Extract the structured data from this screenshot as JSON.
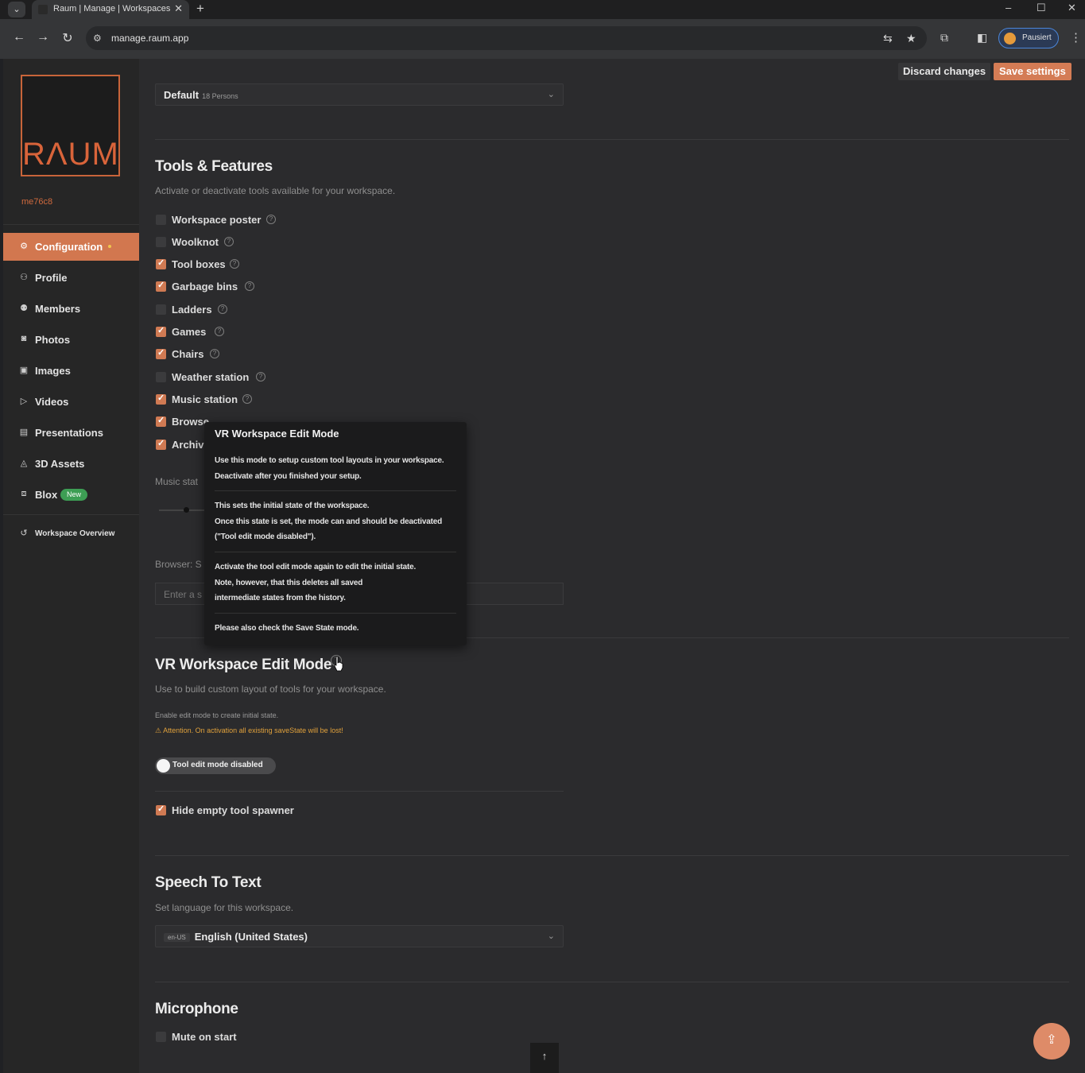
{
  "browser": {
    "tab_title": "Raum | Manage | Workspaces",
    "tab_close": "✕",
    "new_tab": "+",
    "url": "manage.raum.app",
    "profile_label": "Pausiert",
    "window_controls": [
      "–",
      "☐",
      "✕"
    ]
  },
  "sidebar": {
    "logo_text": "RΛUM",
    "user_tag": "me76c8",
    "items": [
      {
        "label": "Configuration",
        "icon": "gear-icon",
        "active": true
      },
      {
        "label": "Profile",
        "icon": "person-icon"
      },
      {
        "label": "Members",
        "icon": "members-icon"
      },
      {
        "label": "Photos",
        "icon": "camera-icon"
      },
      {
        "label": "Images",
        "icon": "image-icon"
      },
      {
        "label": "Videos",
        "icon": "video-icon"
      },
      {
        "label": "Presentations",
        "icon": "presentation-icon"
      },
      {
        "label": "3D Assets",
        "icon": "3d-icon"
      },
      {
        "label": "Blox",
        "icon": "blox-icon",
        "badge": "New"
      },
      {
        "label": "Workspace Overview",
        "icon": "back-icon"
      }
    ]
  },
  "header": {
    "discard_label": "Discard changes",
    "save_label": "Save settings"
  },
  "default_select": {
    "value": "Default",
    "sub": "18 Persons"
  },
  "tools": {
    "title": "Tools & Features",
    "description": "Activate or deactivate tools available for your workspace.",
    "items": [
      {
        "label": "Workspace poster",
        "checked": false
      },
      {
        "label": "Woolknot",
        "checked": false
      },
      {
        "label": "Tool boxes",
        "checked": true
      },
      {
        "label": "Garbage bins",
        "checked": true
      },
      {
        "label": "Ladders",
        "checked": false
      },
      {
        "label": "Games",
        "checked": true
      },
      {
        "label": "Chairs",
        "checked": true
      },
      {
        "label": "Weather station",
        "checked": false
      },
      {
        "label": "Music station",
        "checked": true
      },
      {
        "label": "Browse",
        "checked": true
      },
      {
        "label": "Archiv",
        "checked": true
      }
    ],
    "music_label": "Music stat",
    "browser_label": "Browser: S",
    "browser_placeholder": "Enter a s"
  },
  "tooltip": {
    "title": "VR Workspace Edit Mode",
    "lines": [
      "Use this mode to setup custom tool layouts in your workspace.",
      "Deactivate after you finished your setup.",
      "This sets the initial state of the workspace.",
      "Once this state is set, the mode can and should be deactivated",
      "(\"Tool edit mode disabled\").",
      "Activate the tool edit mode again to edit the initial state.",
      "Note, however, that this deletes all saved",
      "intermediate states from the history.",
      "Please also check the Save State mode."
    ]
  },
  "edit_mode": {
    "title": "VR Workspace Edit Mode",
    "description": "Use to build custom layout of tools for your workspace.",
    "note": "Enable edit mode to create initial state.",
    "warning": "Attention. On activation all existing saveState will be lost!",
    "toggle_label": "Tool edit mode disabled",
    "hide_spawner_label": "Hide empty tool spawner"
  },
  "speech": {
    "title": "Speech To Text",
    "description": "Set language for this workspace.",
    "lang_code": "en-US",
    "lang_value": "English (United States)"
  },
  "microphone": {
    "title": "Microphone",
    "mute_label": "Mute on start"
  },
  "colors": {
    "accent": "#d2774f",
    "badge_green": "#3d9e54",
    "warning": "#e0a13c"
  }
}
